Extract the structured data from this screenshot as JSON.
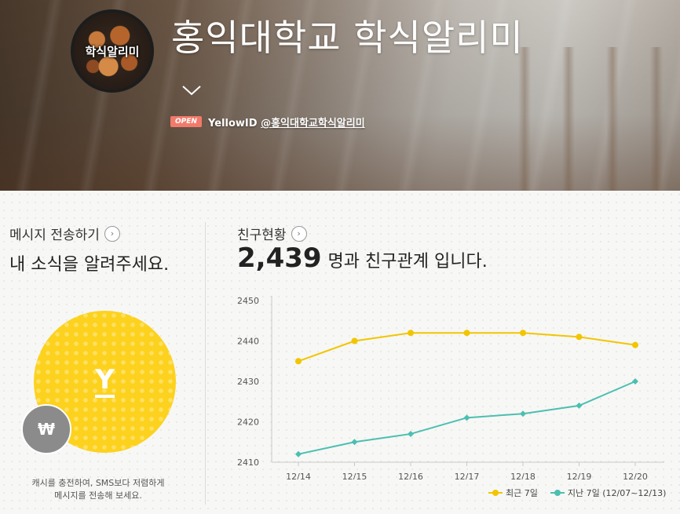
{
  "header": {
    "logo_text": "학식알리미",
    "title": "홍익대학교 학식알리미",
    "open_badge": "OPEN",
    "yellowid_label": "YellowID",
    "yellowid_handle": "@홍익대학교학식알리미"
  },
  "message": {
    "label": "메시지 전송하기",
    "subtitle": "내 소식을 알려주세요.",
    "y_icon": "Y",
    "won_icon": "₩",
    "recharge_line1": "캐시를 충전하여, SMS보다 저렴하게",
    "recharge_line2": "메시지를 전송해 보세요."
  },
  "friends": {
    "label": "친구현황",
    "count": "2,439",
    "suffix": "명과 친구관계 입니다."
  },
  "colors": {
    "recent": "#f2c500",
    "previous": "#4bbfb1"
  },
  "chart_data": {
    "type": "line",
    "categories": [
      "12/14",
      "12/15",
      "12/16",
      "12/17",
      "12/18",
      "12/19",
      "12/20"
    ],
    "series": [
      {
        "name": "최근 7일",
        "values": [
          2435,
          2440,
          2442,
          2442,
          2442,
          2441,
          2439
        ]
      },
      {
        "name": "지난 7일 (12/07~12/13)",
        "values": [
          2412,
          2415,
          2417,
          2421,
          2422,
          2424,
          2430
        ]
      }
    ],
    "yticks": [
      "2450",
      "2440",
      "2430",
      "2420",
      "2410"
    ],
    "ylim": [
      2410,
      2450
    ],
    "grid": false,
    "legend": "bottom-right"
  }
}
